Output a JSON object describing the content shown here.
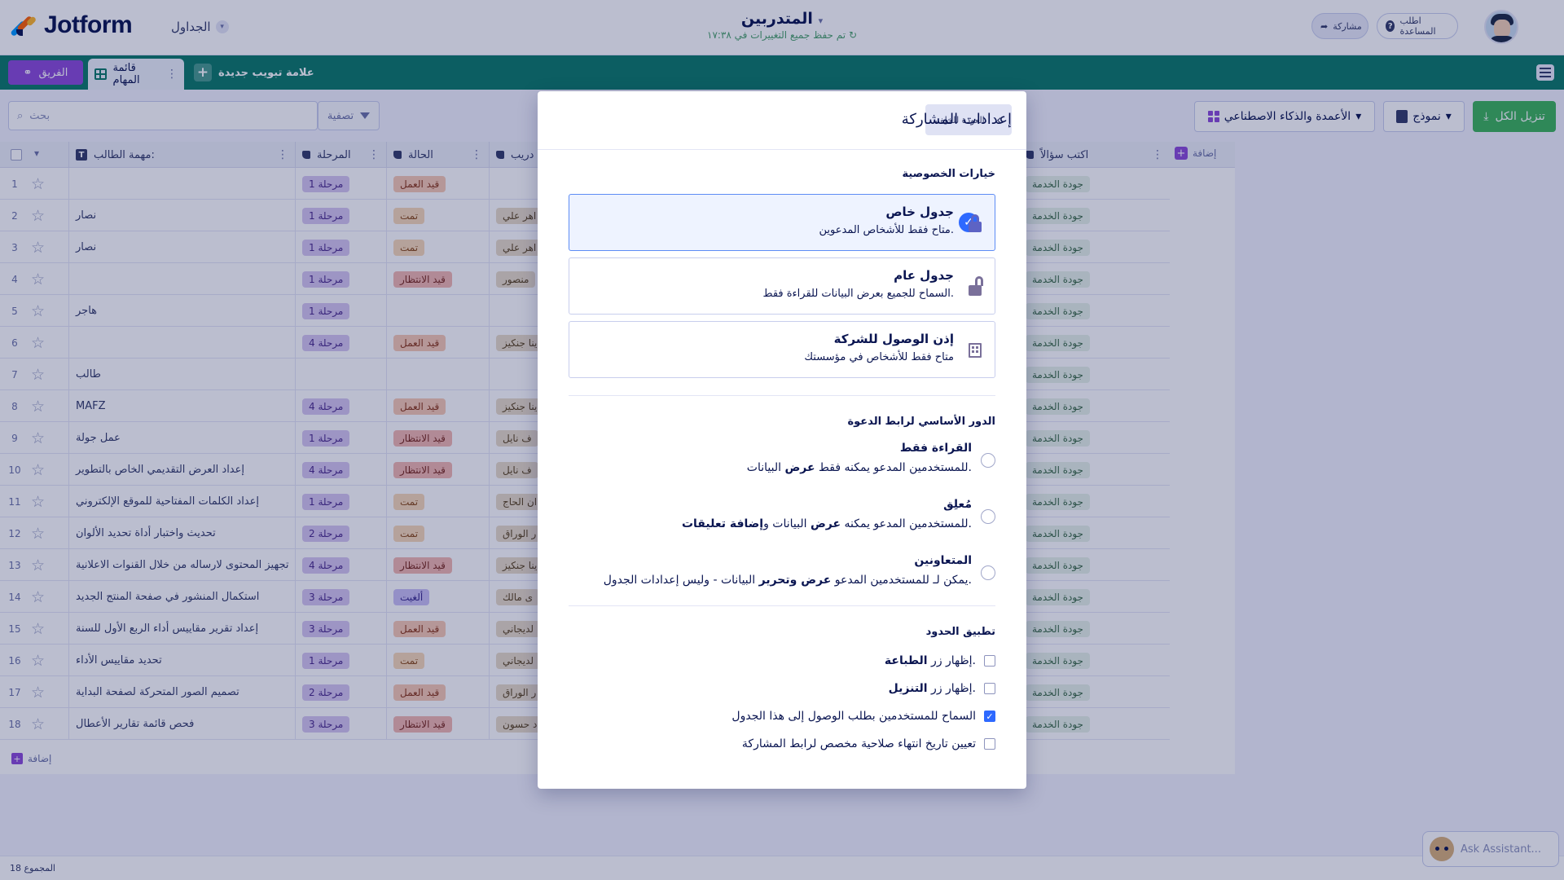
{
  "header": {
    "logo_text": "Jotform",
    "tables_menu": "الجداول",
    "title": "المتدربين",
    "save_status": "تم حفظ جميع التغييرات في ١٧:٣٨",
    "share_label": "مشاركة",
    "help_label": "اطلب المساعدة"
  },
  "tabs": {
    "team_label": "الفريق",
    "active_tab": "قائمة المهام",
    "new_tab": "علامة تبويب جديدة"
  },
  "toolbar": {
    "search_placeholder": "بحث",
    "filter_label": "تصفية",
    "download_all": "تنزيل الكل",
    "form_label": "نموذج",
    "ai_columns": "الأعمدة والذكاء الاصطناعي"
  },
  "table": {
    "columns": [
      {
        "label": "مهمة الطالب:"
      },
      {
        "label": "المرحلة"
      },
      {
        "label": "الحالة"
      },
      {
        "label": "دريب"
      },
      {
        "label": "اكتب سؤالاً"
      }
    ],
    "add_column": "إضافة",
    "add_row": "إضافة",
    "rows": [
      {
        "n": "1",
        "task": "",
        "stage": "مرحلة 1",
        "status": "قيد العمل",
        "status_type": "prog",
        "person": "",
        "q": "جودة الخدمة"
      },
      {
        "n": "2",
        "task": "نصار",
        "stage": "مرحلة 1",
        "status": "تمت",
        "status_type": "done",
        "person": "اهر علي",
        "q": "جودة الخدمة"
      },
      {
        "n": "3",
        "task": "نصار",
        "stage": "مرحلة 1",
        "status": "تمت",
        "status_type": "done",
        "person": "اهر علي",
        "q": "جودة الخدمة"
      },
      {
        "n": "4",
        "task": "",
        "stage": "مرحلة 1",
        "status": "قيد الانتظار",
        "status_type": "wait",
        "person": "منصور",
        "q": "جودة الخدمة"
      },
      {
        "n": "5",
        "task": "هاجر",
        "stage": "مرحلة 1",
        "status": "",
        "status_type": "",
        "person": "",
        "q": "جودة الخدمة"
      },
      {
        "n": "6",
        "task": "",
        "stage": "مرحلة 4",
        "status": "قيد العمل",
        "status_type": "prog",
        "person": "ينا جنكيز",
        "q": "جودة الخدمة"
      },
      {
        "n": "7",
        "task": "طالب",
        "stage": "",
        "status": "",
        "status_type": "",
        "person": "",
        "q": "جودة الخدمة"
      },
      {
        "n": "8",
        "task": "MAFZ",
        "stage": "مرحلة 4",
        "status": "قيد العمل",
        "status_type": "prog",
        "person": "ينا جنكيز",
        "q": "جودة الخدمة"
      },
      {
        "n": "9",
        "task": "عمل جولة",
        "stage": "مرحلة 1",
        "status": "قيد الانتظار",
        "status_type": "wait",
        "person": "ف نايل",
        "q": "جودة الخدمة"
      },
      {
        "n": "10",
        "task": "إعداد العرض التقديمي الخاص بالتطوير",
        "stage": "مرحلة 4",
        "status": "قيد الانتظار",
        "status_type": "wait",
        "person": "ف نايل",
        "q": "جودة الخدمة"
      },
      {
        "n": "11",
        "task": "إعداد الكلمات المفتاحية للموقع الإلكتروني",
        "stage": "مرحلة 1",
        "status": "تمت",
        "status_type": "done",
        "person": "ان الحاج",
        "q": "جودة الخدمة"
      },
      {
        "n": "12",
        "task": "تحديث واختبار أداة تحديد الألوان",
        "stage": "مرحلة 2",
        "status": "تمت",
        "status_type": "done",
        "person": "ر الوراق",
        "q": "جودة الخدمة"
      },
      {
        "n": "13",
        "task": "تجهيز المحتوى لارساله من خلال القنوات الاعلانية",
        "stage": "مرحلة 4",
        "status": "قيد الانتظار",
        "status_type": "wait",
        "person": "ينا جنكيز",
        "q": "جودة الخدمة"
      },
      {
        "n": "14",
        "task": "استكمال المنشور في صفحة المنتج الجديد",
        "stage": "مرحلة 3",
        "status": "ألغيت",
        "status_type": "late",
        "person": "ى مالك",
        "q": "جودة الخدمة"
      },
      {
        "n": "15",
        "task": "إعداد تقرير مقاييس أداء الربع الأول للسنة",
        "stage": "مرحلة 3",
        "status": "قيد العمل",
        "status_type": "prog",
        "person": "لديجاني",
        "q": "جودة الخدمة"
      },
      {
        "n": "16",
        "task": "تحديد مقاييس الأداء",
        "stage": "مرحلة 1",
        "status": "تمت",
        "status_type": "done",
        "person": "لديجاني",
        "q": "جودة الخدمة"
      },
      {
        "n": "17",
        "task": "تصميم الصور المتحركة لصفحة البداية",
        "stage": "مرحلة 2",
        "status": "قيد العمل",
        "status_type": "prog",
        "person": "ر الوراق",
        "q": "جودة الخدمة"
      },
      {
        "n": "18",
        "task": "فحص قائمة تقارير الأعطال",
        "stage": "مرحلة 3",
        "status": "قيد الانتظار",
        "status_type": "wait",
        "person": "د حسون",
        "q": "جودة الخدمة"
      }
    ]
  },
  "footer": {
    "total_label": "المجموع",
    "total_count": "18"
  },
  "assistant": {
    "label": "Ask Assistant..."
  },
  "modal": {
    "title": "إعدادات المشاركة",
    "back_label": "العودة للخلف",
    "privacy_title": "خيارات الخصوصية",
    "privacy_options": [
      {
        "name": "جدول خاص",
        "desc": "متاح فقط للأشخاص المدعوين.",
        "selected": true
      },
      {
        "name": "جدول عام",
        "desc": "السماح للجميع بعرض البيانات للقراءة فقط.",
        "selected": false
      },
      {
        "name": "إذن الوصول للشركة",
        "desc": "متاح فقط للأشخاص في مؤسستك",
        "selected": false
      }
    ],
    "role_title": "الدور الأساسي لرابط الدعوة",
    "roles": [
      {
        "name": "القراءة فقط",
        "desc_before": "للمستخدمين المدعو يمكنه فقط ",
        "desc_bold": "عرض",
        "desc_after": " البيانات."
      },
      {
        "name": "مُعلِق",
        "desc_before": "للمستخدمين المدعو يمكنه ",
        "desc_bold": "عرض",
        "desc_after": " البيانات و",
        "desc_bold2": "إضافة تعليقات",
        "desc_end": "."
      },
      {
        "name": "المتعاونين",
        "desc_before": "يمكن لـ للمستخدمين المدعو ",
        "desc_bold": "عرض وتحرير",
        "desc_after": " البيانات - وليس إعدادات الجدول."
      }
    ],
    "limits_title": "تطبيق الحدود",
    "limits": [
      {
        "before": "إظهار زر ",
        "bold": "الطباعة",
        "after": ".",
        "checked": false
      },
      {
        "before": "إظهار زر ",
        "bold": "التنزيل",
        "after": ".",
        "checked": false
      },
      {
        "before": "السماح للمستخدمين بطلب الوصول إلى هذا الجدول",
        "bold": "",
        "after": "",
        "checked": true
      },
      {
        "before": "تعيين تاريخ انتهاء صلاحية مخصص لرابط المشاركة",
        "bold": "",
        "after": "",
        "checked": false
      }
    ]
  }
}
